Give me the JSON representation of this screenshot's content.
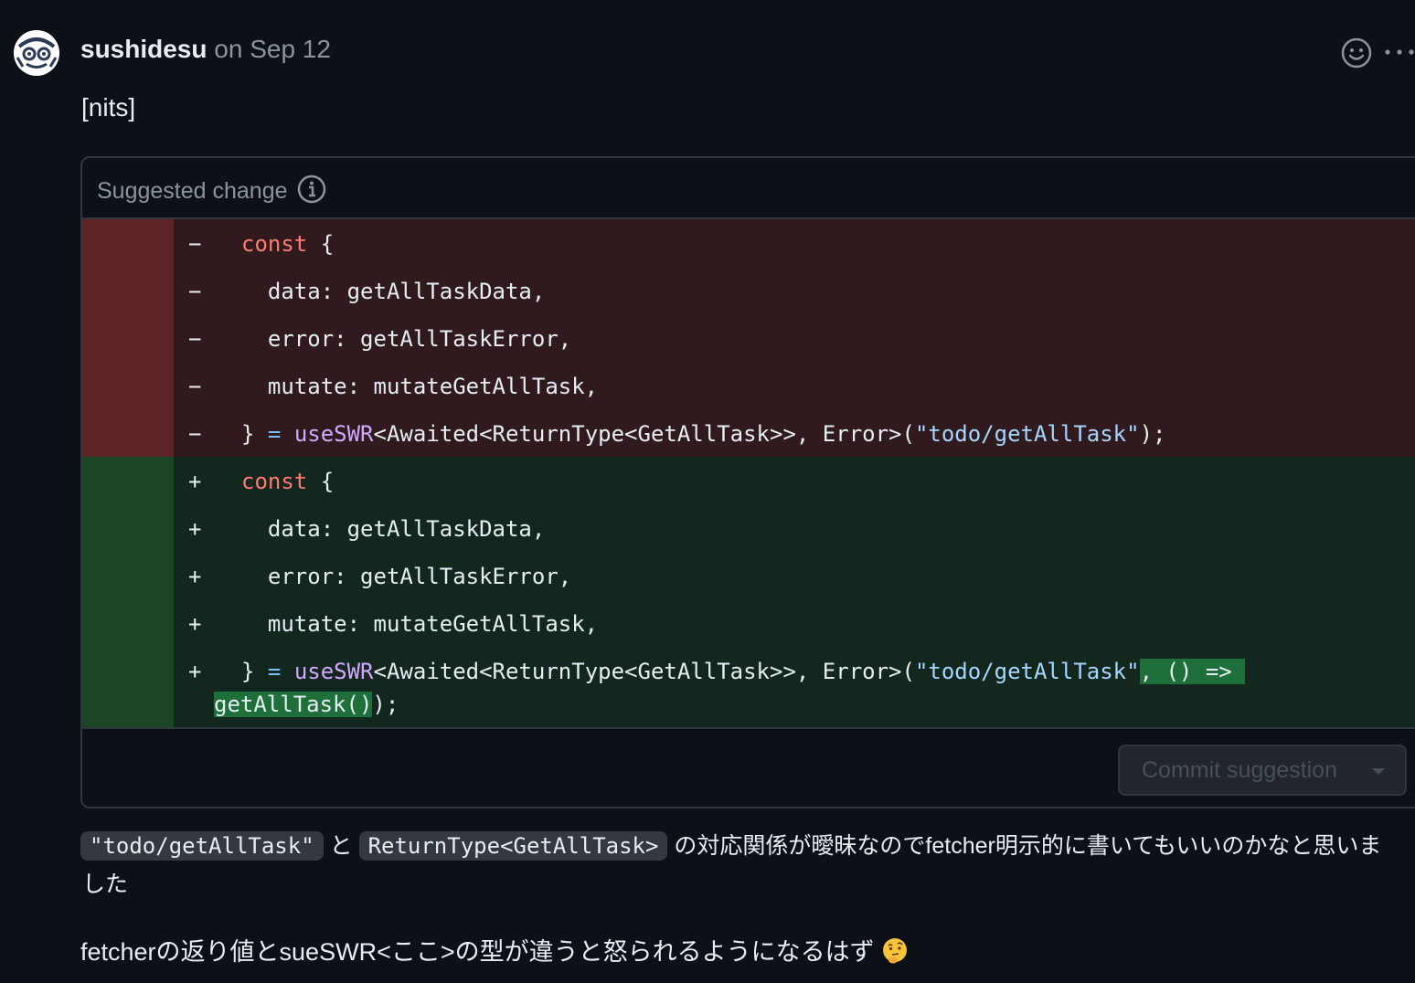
{
  "comment": {
    "author": "sushidesu",
    "date": "on Sep 12",
    "text": "[nits]"
  },
  "icons": {
    "avatar": "avatar-icon",
    "reaction": "smiley-icon",
    "more": "kebab-horizontal-icon",
    "info": "info-icon",
    "caret": "triangle-down-icon",
    "emoji": "thinking-face-emoji"
  },
  "suggestion": {
    "title": "Suggested change",
    "deleted_lines": [
      {
        "sign": "−",
        "kw": "const",
        "rest": " {"
      },
      {
        "sign": "−",
        "text": "  data: getAllTaskData,"
      },
      {
        "sign": "−",
        "text": "  error: getAllTaskError,"
      },
      {
        "sign": "−",
        "text": "  mutate: mutateGetAllTask,"
      },
      {
        "sign": "−",
        "p1": "} ",
        "eq": "=",
        "sp": " ",
        "fn": "useSWR",
        "generic": "<Awaited<ReturnType<GetAllTask>>, Error>(",
        "str": "\"todo/getAllTask\"",
        "end": ");"
      }
    ],
    "added_lines": [
      {
        "sign": "+",
        "kw": "const",
        "rest": " {"
      },
      {
        "sign": "+",
        "text": "  data: getAllTaskData,"
      },
      {
        "sign": "+",
        "text": "  error: getAllTaskError,"
      },
      {
        "sign": "+",
        "text": "  mutate: mutateGetAllTask,"
      },
      {
        "sign": "+",
        "p1": "} ",
        "eq": "=",
        "sp": " ",
        "fn": "useSWR",
        "generic": "<Awaited<ReturnType<GetAllTask>>, Error>(",
        "str": "\"todo/getAllTask\"",
        "hl1": ", () => ",
        "hl2": "getAllTask()",
        "end": ");"
      }
    ],
    "commit_button": "Commit suggestion"
  },
  "body": {
    "code1": "\"todo/getAllTask\"",
    "and": "と",
    "code2": "ReturnType<GetAllTask>",
    "sentence1": "の対応関係が曖昧なのでfetcher明示的に書いてもいいのかなと思いま",
    "sentence1b": "した",
    "sentence2": "fetcherの返り値とsueSWR<ここ>の型が違うと怒られるようになるはず"
  }
}
